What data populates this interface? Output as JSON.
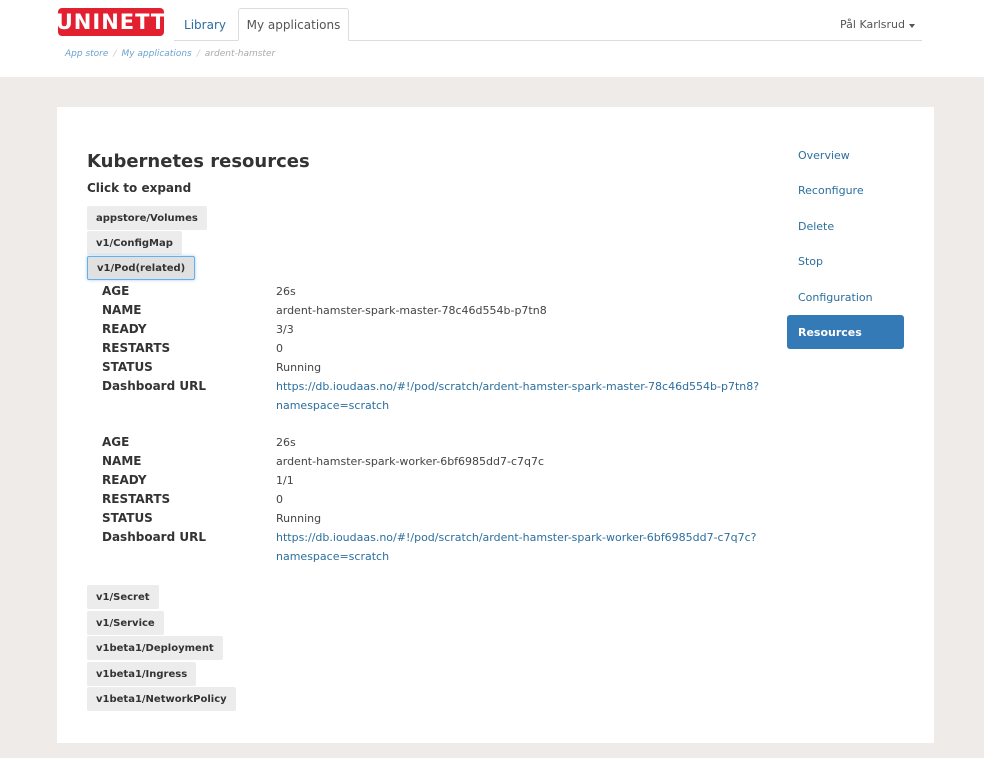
{
  "header": {
    "logo_text": "UNINETT",
    "tabs": [
      {
        "label": "Library"
      },
      {
        "label": "My applications"
      }
    ],
    "user_name": "Pål Karlsrud"
  },
  "breadcrumb": {
    "items": [
      "App store",
      "My applications",
      "ardent-hamster"
    ],
    "separator": "/"
  },
  "main": {
    "title": "Kubernetes resources",
    "hint": "Click to expand",
    "resources_top": [
      "appstore/Volumes",
      "v1/ConfigMap",
      "v1/Pod(related)"
    ],
    "resources_bottom": [
      "v1/Secret",
      "v1/Service",
      "v1beta1/Deployment",
      "v1beta1/Ingress",
      "v1beta1/NetworkPolicy"
    ],
    "pods": [
      {
        "age_label": "AGE",
        "age": "26s",
        "name_label": "NAME",
        "name": "ardent-hamster-spark-master-78c46d554b-p7tn8",
        "ready_label": "READY",
        "ready": "3/3",
        "restarts_label": "RESTARTS",
        "restarts": "0",
        "status_label": "STATUS",
        "status": "Running",
        "url_label": "Dashboard URL",
        "url_line1": "https://db.ioudaas.no/#!/pod/scratch/ardent-hamster-spark-master-78c46d554b-p7tn8?",
        "url_line2": "namespace=scratch"
      },
      {
        "age_label": "AGE",
        "age": "26s",
        "name_label": "NAME",
        "name": "ardent-hamster-spark-worker-6bf6985dd7-c7q7c",
        "ready_label": "READY",
        "ready": "1/1",
        "restarts_label": "RESTARTS",
        "restarts": "0",
        "status_label": "STATUS",
        "status": "Running",
        "url_label": "Dashboard URL",
        "url_line1": "https://db.ioudaas.no/#!/pod/scratch/ardent-hamster-spark-worker-6bf6985dd7-c7q7c?",
        "url_line2": "namespace=scratch"
      }
    ]
  },
  "sidebar": {
    "items": [
      {
        "label": "Overview"
      },
      {
        "label": "Reconfigure"
      },
      {
        "label": "Delete"
      },
      {
        "label": "Stop"
      },
      {
        "label": "Configuration"
      },
      {
        "label": "Resources"
      }
    ],
    "active_index": 5
  },
  "colors": {
    "brand_red": "#e2202f",
    "link_blue": "#2c6f9e",
    "active_blue": "#337ab7",
    "page_bg": "#efebe8"
  }
}
